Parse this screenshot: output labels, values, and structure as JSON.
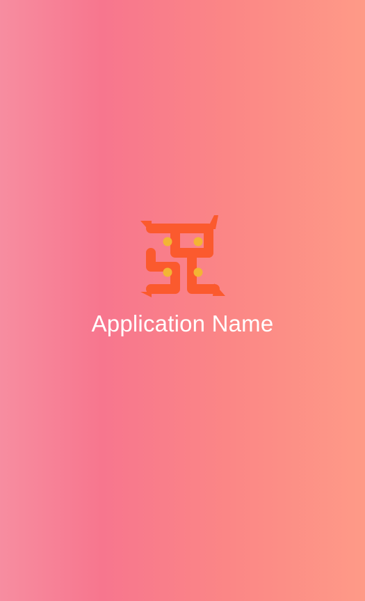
{
  "splash": {
    "app_name": "Application Name",
    "logo_icon": "swastika-icon",
    "colors": {
      "gradient_left": "#f78da0",
      "gradient_mid": "#f7768e",
      "gradient_right": "#fe9a87",
      "logo_orange": "#fb5a2e",
      "logo_dots": "#f3b534",
      "text": "#ffffff"
    }
  }
}
